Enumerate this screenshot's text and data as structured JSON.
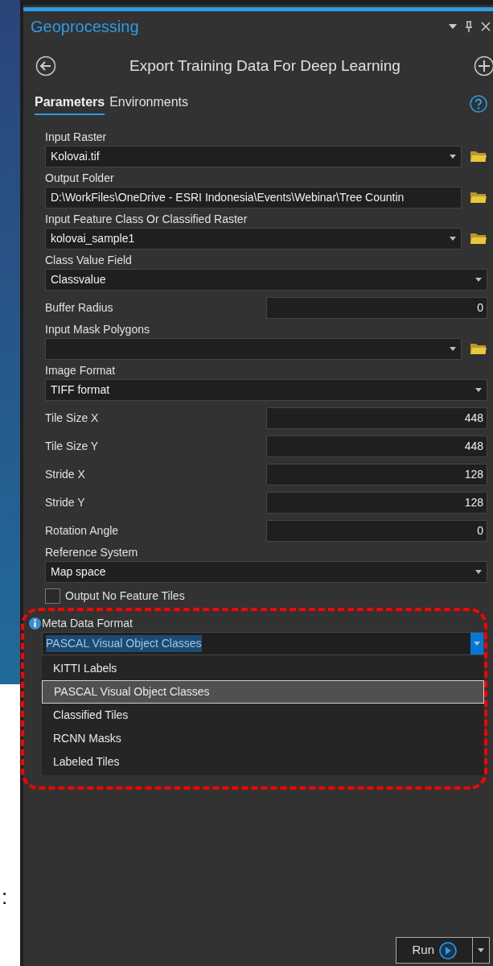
{
  "backdrop_text": ":",
  "pane": {
    "title": "Geoprocessing",
    "tool_title": "Export Training Data For Deep Learning"
  },
  "tabs": [
    {
      "label": "Parameters",
      "selected": true
    },
    {
      "label": "Environments",
      "selected": false
    }
  ],
  "parameters": [
    {
      "kind": "stacked",
      "label": "Input Raster",
      "value": "Kolovai.tif",
      "dropdown": true,
      "browse": true
    },
    {
      "kind": "stacked",
      "label": "Output Folder",
      "value": "D:\\WorkFiles\\OneDrive - ESRI Indonesia\\Events\\Webinar\\Tree Countin",
      "dropdown": false,
      "browse": true
    },
    {
      "kind": "stacked",
      "label": "Input Feature Class Or Classified Raster",
      "value": "kolovai_sample1",
      "dropdown": true,
      "browse": true
    },
    {
      "kind": "stacked",
      "label": "Class Value Field",
      "value": "Classvalue",
      "dropdown": true,
      "browse": false
    },
    {
      "kind": "inline",
      "label": "Buffer Radius",
      "value": "0"
    },
    {
      "kind": "stacked",
      "label": "Input Mask Polygons",
      "dropdown": true,
      "browse": true
    },
    {
      "kind": "stacked",
      "label": "Image Format",
      "value": "TIFF format",
      "dropdown": true,
      "browse": false
    },
    {
      "kind": "inline",
      "label": "Tile Size X",
      "value": "448"
    },
    {
      "kind": "inline",
      "label": "Tile Size Y",
      "value": "448"
    },
    {
      "kind": "inline",
      "label": "Stride X",
      "value": "128"
    },
    {
      "kind": "inline",
      "label": "Stride Y",
      "value": "128"
    },
    {
      "kind": "inline",
      "label": "Rotation Angle",
      "value": "0"
    },
    {
      "kind": "stacked",
      "label": "Reference System",
      "value": "Map space",
      "dropdown": true,
      "browse": false
    },
    {
      "kind": "checkbox",
      "label": "Output No Feature Tiles",
      "checked": false
    }
  ],
  "meta_data_format": {
    "label": "Meta Data Format",
    "value": "PASCAL Visual Object Classes",
    "options": [
      {
        "label": "KITTI Labels",
        "selected": false
      },
      {
        "label": "PASCAL Visual Object Classes",
        "selected": true
      },
      {
        "label": "Classified Tiles",
        "selected": false
      },
      {
        "label": "RCNN Masks",
        "selected": false
      },
      {
        "label": "Labeled Tiles",
        "selected": false
      }
    ]
  },
  "run_button": "Run"
}
